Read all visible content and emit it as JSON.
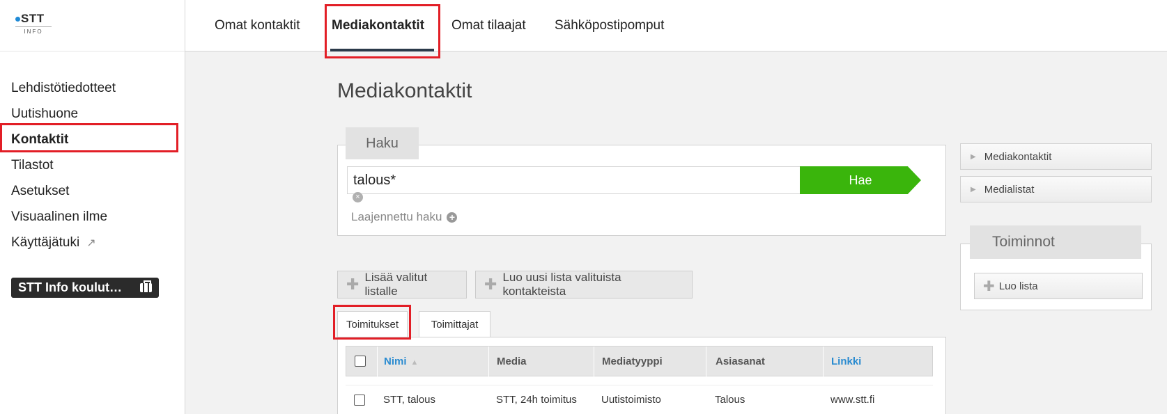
{
  "logo": {
    "top": "STT",
    "sub": "INFO"
  },
  "sidebar": {
    "items": [
      {
        "label": "Lehdistötiedotteet"
      },
      {
        "label": "Uutishuone"
      },
      {
        "label": "Kontaktit"
      },
      {
        "label": "Tilastot"
      },
      {
        "label": "Asetukset"
      },
      {
        "label": "Visuaalinen ilme"
      },
      {
        "label": "Käyttäjätuki",
        "external_icon": "↗"
      }
    ],
    "active": "Kontaktit",
    "course_button": "STT Info koulut…"
  },
  "topnav": {
    "tabs": [
      {
        "label": "Omat kontaktit"
      },
      {
        "label": "Mediakontaktit"
      },
      {
        "label": "Omat tilaajat"
      },
      {
        "label": "Sähköpostipomput"
      }
    ],
    "active": "Mediakontaktit"
  },
  "main": {
    "title": "Mediakontaktit",
    "search": {
      "section_label": "Haku",
      "value": "talous*",
      "button": "Hae",
      "clear_icon": "×",
      "advanced_label": "Laajennettu haku",
      "advanced_icon": "+"
    },
    "actions": {
      "add_to_list": "Lisää valitut listalle",
      "create_list": "Luo uusi lista valituista kontakteista",
      "plus_icon": "✚"
    },
    "subtabs": [
      {
        "label": "Toimitukset"
      },
      {
        "label": "Toimittajat"
      }
    ],
    "active_subtab": "Toimitukset",
    "table": {
      "columns": [
        "Nimi",
        "Media",
        "Mediatyyppi",
        "Asiasanat",
        "Linkki"
      ],
      "sort_icon": "▲",
      "rows": [
        {
          "nimi": "STT, talous",
          "media": "STT, 24h toimitus",
          "mediatyyppi": "Uutistoimisto",
          "asiasanat": "Talous",
          "linkki": "www.stt.fi"
        }
      ]
    }
  },
  "right_panel": {
    "links": [
      {
        "label": "Mediakontaktit",
        "icon": "▶"
      },
      {
        "label": "Medialistat",
        "icon": "▶"
      }
    ],
    "actions_title": "Toiminnot",
    "create_list_button": "Luo lista",
    "plus_icon": "✚"
  },
  "colors": {
    "accent_green": "#3ab50c",
    "highlight_red": "#e21e26",
    "link_blue": "#2a8bd0",
    "dark": "#2b2b2b"
  }
}
